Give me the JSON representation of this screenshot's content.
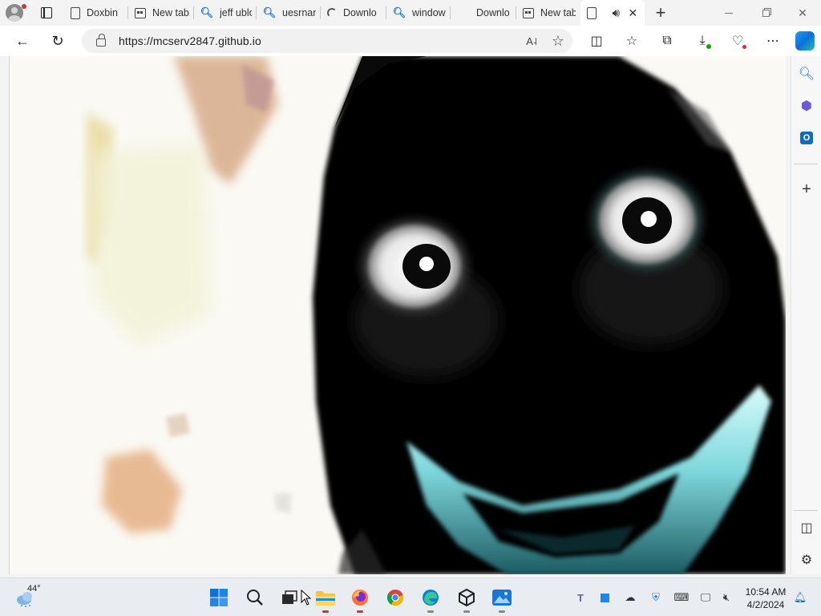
{
  "browser": {
    "tabs": [
      {
        "label": "Doxbin",
        "icon": "document-icon"
      },
      {
        "label": "New tab",
        "icon": "new-tab-icon"
      },
      {
        "label": "jeff ublo",
        "icon": "search-icon"
      },
      {
        "label": "uesrnam",
        "icon": "search-icon"
      },
      {
        "label": "Downlo",
        "icon": "loading-icon"
      },
      {
        "label": "window",
        "icon": "search-icon"
      },
      {
        "label": "Downlo",
        "icon": "none"
      },
      {
        "label": "New tab",
        "icon": "new-tab-icon"
      },
      {
        "label": "",
        "icon": "document-icon",
        "active": true,
        "audio": true
      }
    ],
    "address": {
      "url": "https://mcserv2847.github.io"
    }
  },
  "taskbar": {
    "weather": {
      "temp": "44°"
    },
    "apps": [
      {
        "name": "start-button"
      },
      {
        "name": "search-button"
      },
      {
        "name": "task-view"
      },
      {
        "name": "file-explorer"
      },
      {
        "name": "firefox"
      },
      {
        "name": "chrome"
      },
      {
        "name": "edge"
      },
      {
        "name": "unity"
      },
      {
        "name": "photos"
      }
    ],
    "clock": {
      "time": "10:54 AM",
      "date": "4/2/2024"
    }
  },
  "colors": {
    "accent": "#0067c0",
    "page_background": "#faf9f3",
    "creature": "#050505",
    "teeth": "#7fd8dc"
  }
}
